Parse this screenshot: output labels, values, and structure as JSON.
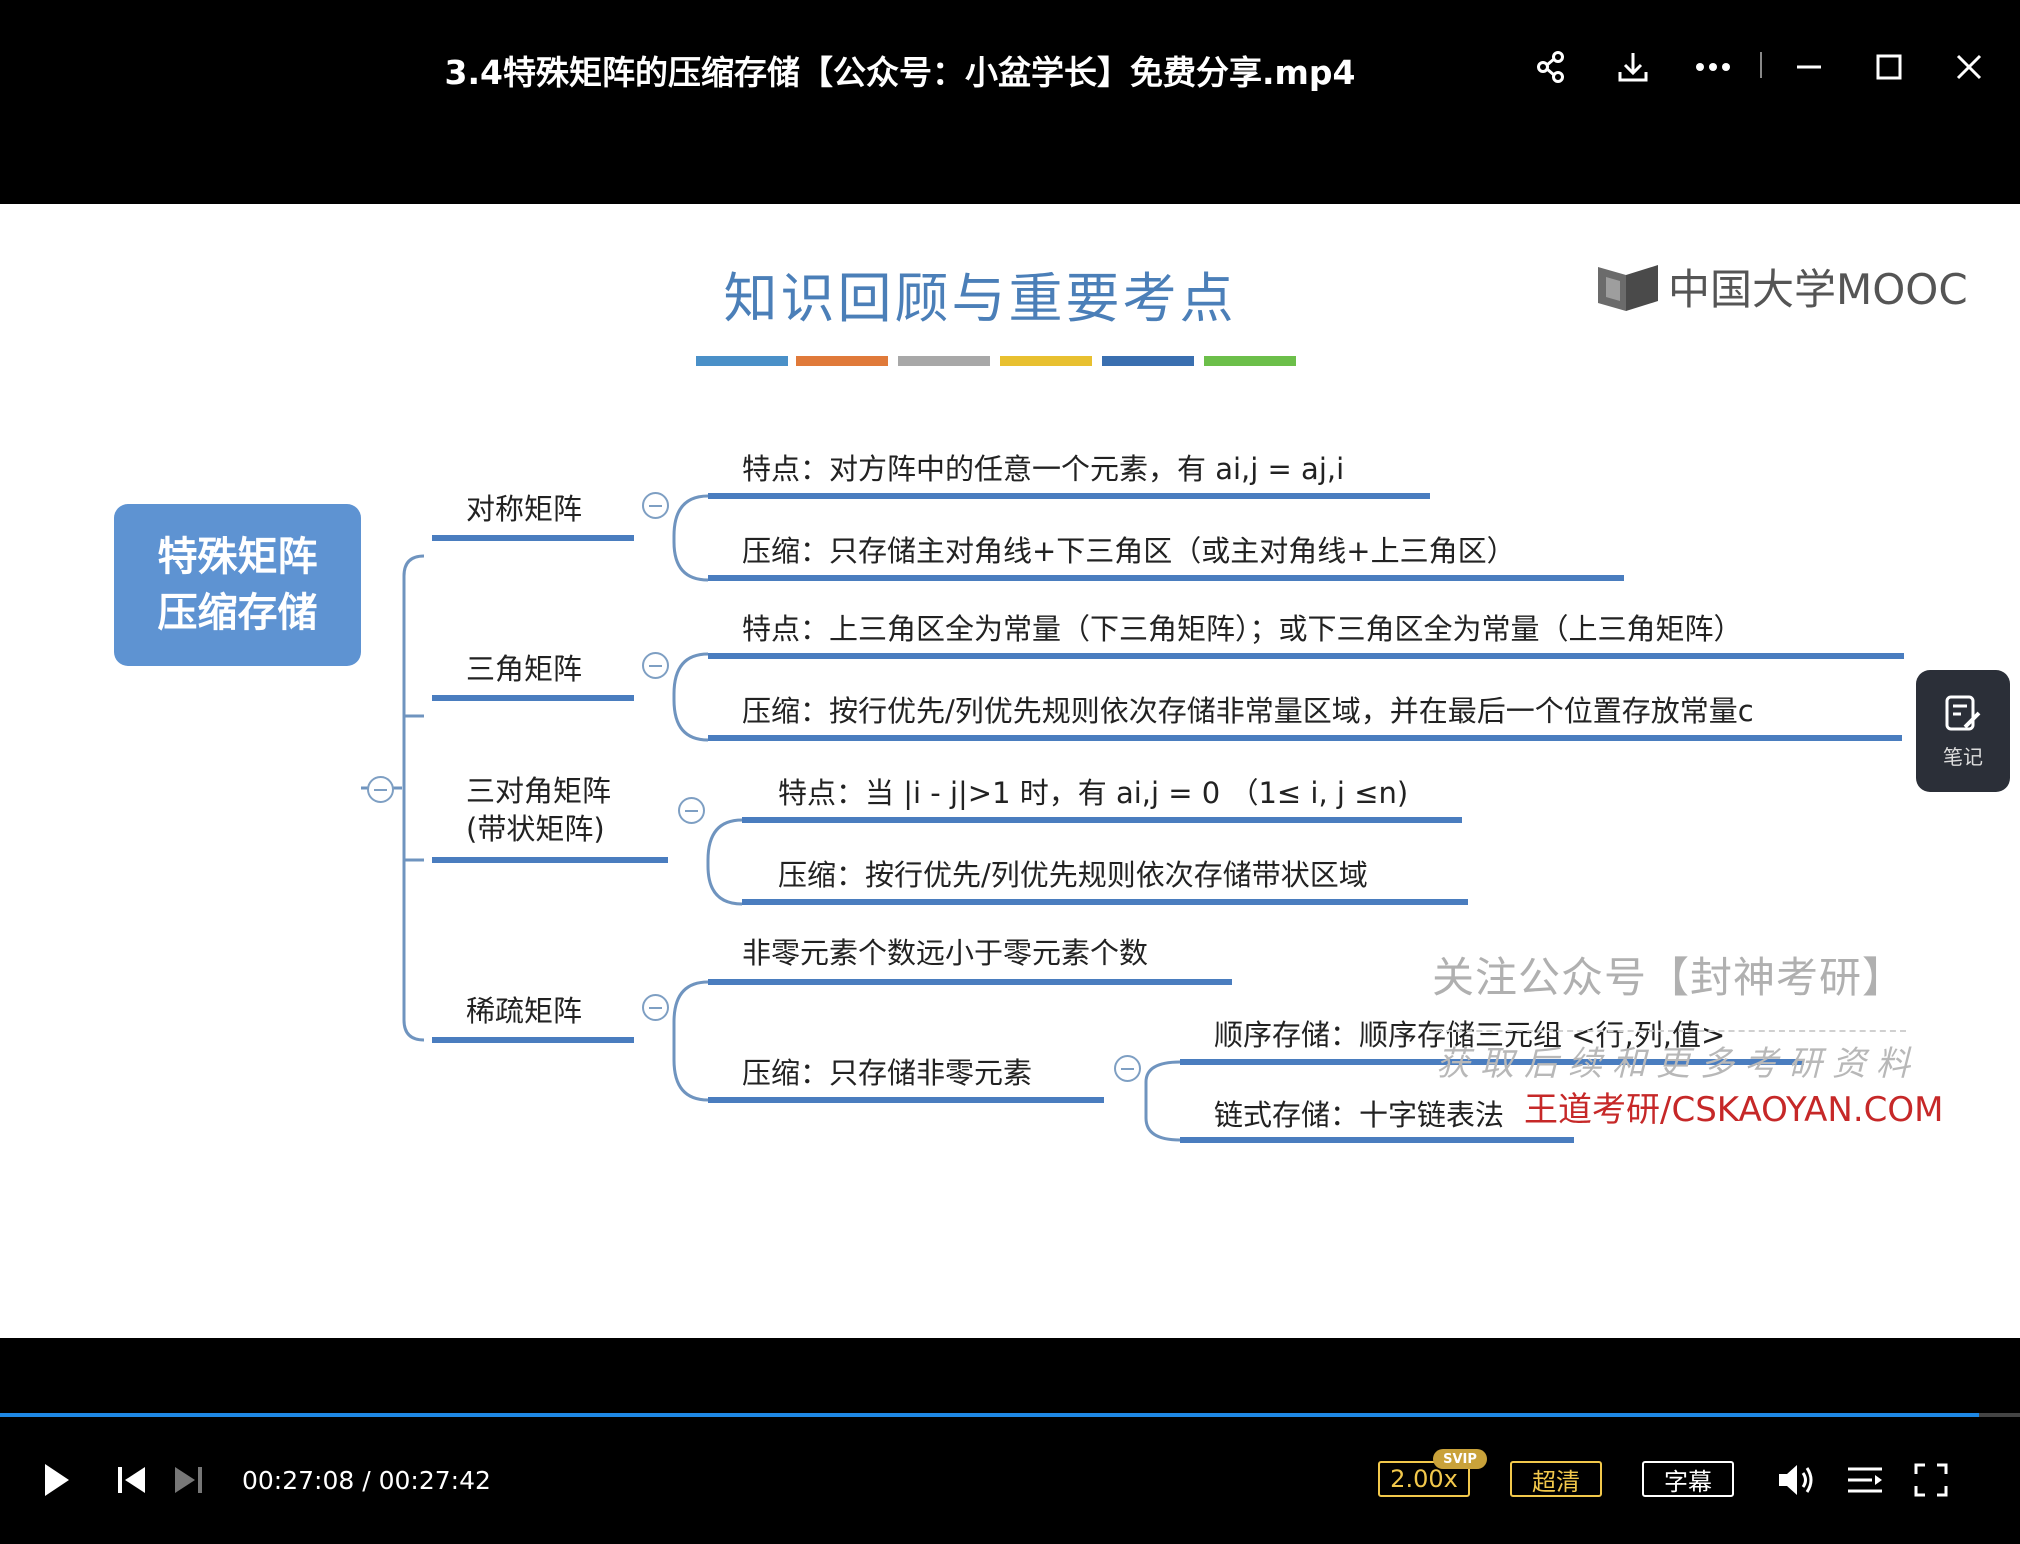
{
  "window": {
    "title": "3.4特殊矩阵的压缩存储【公众号：小盆学长】免费分享.mp4",
    "icons": [
      "share-icon",
      "download-icon",
      "more-icon",
      "minimize-icon",
      "maximize-icon",
      "close-icon"
    ]
  },
  "slide": {
    "title": "知识回顾与重要考点",
    "color_bar": [
      "#4a90c8",
      "#e07a3a",
      "#a8a8a8",
      "#e8c030",
      "#3a6fb0",
      "#6cbf4a"
    ],
    "logo_text": "中国大学MOOC",
    "mindmap": {
      "root": "特殊矩阵\n压缩存储",
      "branches": [
        {
          "label": "对称矩阵",
          "items": [
            "特点：对方阵中的任意一个元素，有 ai,j = aj,i",
            "压缩：只存储主对角线+下三角区（或主对角线+上三角区）"
          ]
        },
        {
          "label": "三角矩阵",
          "items": [
            "特点：上三角区全为常量（下三角矩阵）；或下三角区全为常量（上三角矩阵）",
            "压缩：按行优先/列优先规则依次存储非常量区域，并在最后一个位置存放常量c"
          ]
        },
        {
          "label": "三对角矩阵\n(带状矩阵)",
          "items": [
            "特点：当 |i - j|>1 时，有 ai,j = 0 （1≤ i, j ≤n)",
            "压缩：按行优先/列优先规则依次存储带状区域"
          ]
        },
        {
          "label": "稀疏矩阵",
          "items": [
            "非零元素个数远小于零元素个数",
            "压缩：只存储非零元素"
          ],
          "sub_items": [
            "顺序存储：顺序存储三元组 <行,列,值>",
            "链式存储：十字链表法"
          ]
        }
      ]
    },
    "watermark": {
      "line1": "关注公众号【封神考研】",
      "line2": "获取后续和更多考研资料",
      "line3": "王道考研/CSKAOYAN.COM"
    },
    "notes_button": "笔记"
  },
  "player": {
    "current_time": "00:27:08",
    "total_time": "00:27:42",
    "time_display": "00:27:08 / 00:27:42",
    "progress": 0.9795,
    "speed": "2.00x",
    "speed_badge": "SVIP",
    "quality": "超清",
    "subtitles": "字幕",
    "accent_color": "#1e88e5"
  }
}
